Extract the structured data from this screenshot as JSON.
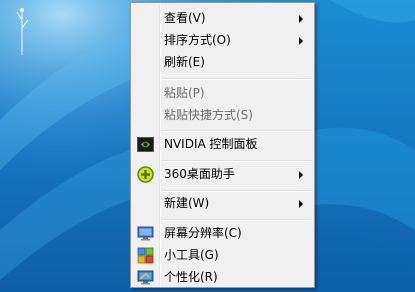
{
  "menu": {
    "items": [
      {
        "label": "查看(V)"
      },
      {
        "label": "排序方式(O)"
      },
      {
        "label": "刷新(E)"
      },
      {
        "label": "粘贴(P)"
      },
      {
        "label": "粘贴快捷方式(S)"
      },
      {
        "label": "NVIDIA 控制面板",
        "icon": "nvidia-icon"
      },
      {
        "label": "360桌面助手",
        "icon": "360-icon"
      },
      {
        "label": "新建(W)"
      },
      {
        "label": "屏幕分辨率(C)",
        "icon": "screen-resolution-icon"
      },
      {
        "label": "小工具(G)",
        "icon": "gadgets-icon"
      },
      {
        "label": "个性化(R)",
        "icon": "personalize-icon"
      }
    ]
  },
  "colors": {
    "desktop": "#1479c4",
    "menu_bg": "#f0f0f0",
    "disabled_text": "#6d6d6d",
    "nvidia_green": "#76b900"
  }
}
